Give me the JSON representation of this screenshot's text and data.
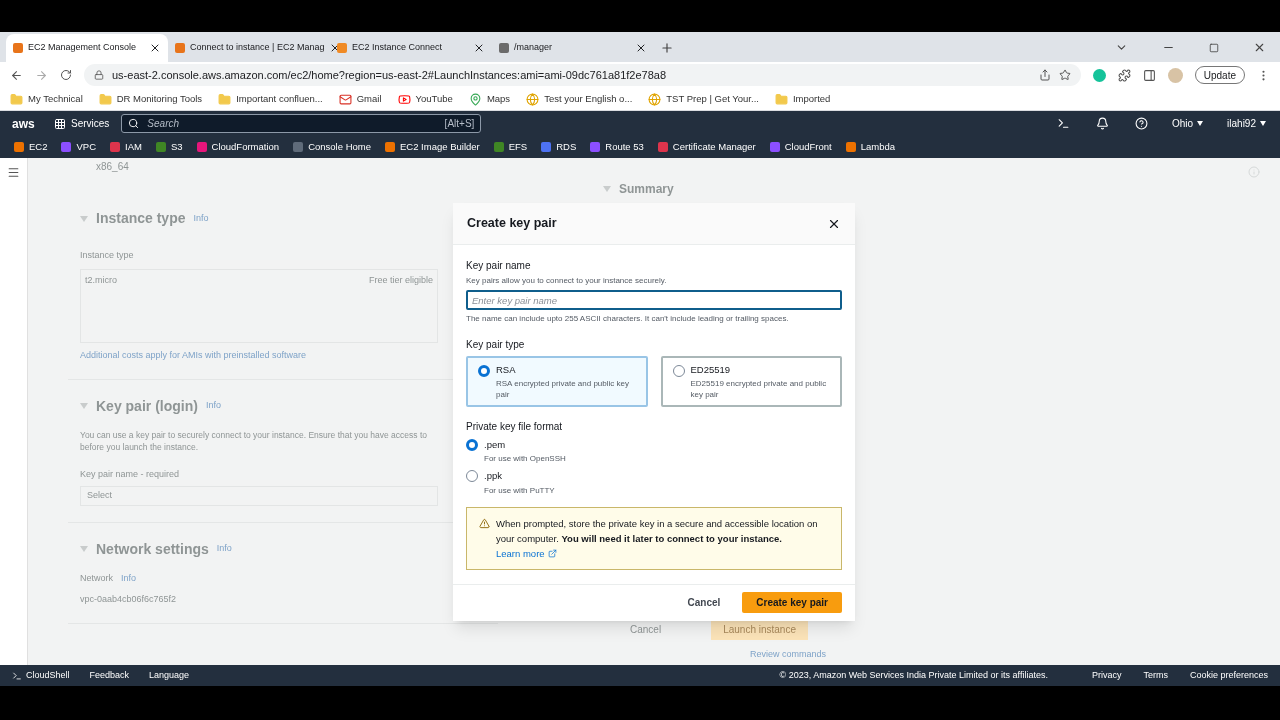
{
  "browser": {
    "tabs": [
      {
        "title": "EC2 Management Console",
        "selected": true,
        "color": "#e8741a"
      },
      {
        "title": "Connect to instance | EC2 Manag",
        "selected": false,
        "color": "#e8741a"
      },
      {
        "title": "EC2 Instance Connect",
        "selected": false,
        "color": "#f08a24"
      },
      {
        "title": "/manager",
        "selected": false,
        "color": "#6b6b6b"
      }
    ],
    "url": "us-east-2.console.aws.amazon.com/ec2/home?region=us-east-2#LaunchInstances:ami=ami-09dc761a81f2e78a8",
    "update": "Update",
    "bookmarks": [
      {
        "label": "My Technical",
        "kind": "folder"
      },
      {
        "label": "DR Monitoring Tools",
        "kind": "folder"
      },
      {
        "label": "Important confluen...",
        "kind": "folder"
      },
      {
        "label": "Gmail",
        "kind": "mail"
      },
      {
        "label": "YouTube",
        "kind": "video"
      },
      {
        "label": "Maps",
        "kind": "pin"
      },
      {
        "label": "Test your English o...",
        "kind": "site"
      },
      {
        "label": "TST Prep | Get Your...",
        "kind": "site"
      },
      {
        "label": "Imported",
        "kind": "folder"
      }
    ]
  },
  "aws": {
    "logo": "aws",
    "services": "Services",
    "search_placeholder": "Search",
    "search_shortcut": "[Alt+S]",
    "region": "Ohio",
    "user": "ilahi92",
    "shortcuts": [
      {
        "label": "EC2",
        "color": "#ed7100"
      },
      {
        "label": "VPC",
        "color": "#8c4fff"
      },
      {
        "label": "IAM",
        "color": "#dd344c"
      },
      {
        "label": "S3",
        "color": "#3f8624"
      },
      {
        "label": "CloudFormation",
        "color": "#e7157b"
      },
      {
        "label": "Console Home",
        "color": "#5f6b7a"
      },
      {
        "label": "EC2 Image Builder",
        "color": "#ed7100"
      },
      {
        "label": "EFS",
        "color": "#3f8624"
      },
      {
        "label": "RDS",
        "color": "#4d72f3"
      },
      {
        "label": "Route 53",
        "color": "#8c4fff"
      },
      {
        "label": "Certificate Manager",
        "color": "#dd344c"
      },
      {
        "label": "CloudFront",
        "color": "#8c4fff"
      },
      {
        "label": "Lambda",
        "color": "#ed7100"
      }
    ]
  },
  "background": {
    "arch": "x86_64",
    "summary": "Summary",
    "instance_type": {
      "title": "Instance type",
      "info": "Info",
      "label": "Instance type",
      "value": "t2.micro",
      "badge": "Free tier eligible",
      "note": "Additional costs apply for AMIs with preinstalled software"
    },
    "key_pair": {
      "title": "Key pair (login)",
      "info": "Info",
      "text": "You can use a key pair to securely connect to your instance. Ensure that you have access to",
      "text2": "before you launch the instance.",
      "label": "Key pair name - required",
      "select": "Select"
    },
    "network": {
      "title": "Network settings",
      "info": "Info",
      "label": "Network",
      "label_info": "Info",
      "value": "vpc-0aab4cb06f6c765f2"
    },
    "cancel": "Cancel",
    "launch": "Launch instance",
    "review": "Review commands"
  },
  "modal": {
    "title": "Create key pair",
    "name_label": "Key pair name",
    "name_desc": "Key pairs allow you to connect to your instance securely.",
    "name_placeholder": "Enter key pair name",
    "name_hint": "The name can include upto 255 ASCII characters. It can't include leading or trailing spaces.",
    "type_label": "Key pair type",
    "types": [
      {
        "label": "RSA",
        "desc": "RSA encrypted private and public key pair",
        "selected": true
      },
      {
        "label": "ED25519",
        "desc": "ED25519 encrypted private and public key pair",
        "selected": false
      }
    ],
    "format_label": "Private key file format",
    "formats": [
      {
        "label": ".pem",
        "desc": "For use with OpenSSH",
        "selected": true
      },
      {
        "label": ".ppk",
        "desc": "For use with PuTTY",
        "selected": false
      }
    ],
    "alert": "When prompted, store the private key in a secure and accessible location on your computer. **You will need it later to connect to your instance.**",
    "alert_link": "Learn more",
    "cancel": "Cancel",
    "create": "Create key pair"
  },
  "footer": {
    "left": [
      "CloudShell",
      "Feedback",
      "Language"
    ],
    "copyright": "© 2023, Amazon Web Services India Private Limited or its affiliates.",
    "links": [
      "Privacy",
      "Terms",
      "Cookie preferences"
    ]
  }
}
